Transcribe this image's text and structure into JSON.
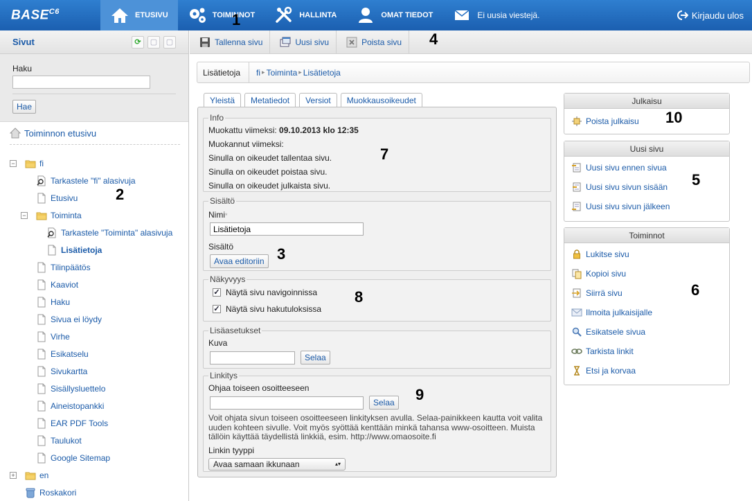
{
  "topbar": {
    "logo": "BASE",
    "logo_sup": "C6",
    "nav": [
      {
        "label": "ETUSIVU",
        "icon": "home-icon"
      },
      {
        "label": "TOIMINNOT",
        "icon": "gears-icon"
      },
      {
        "label": "HALLINTA",
        "icon": "tools-icon"
      },
      {
        "label": "OMAT TIEDOT",
        "icon": "user-icon"
      }
    ],
    "messages": "Ei uusia viestejä.",
    "logout": "Kirjaudu ulos"
  },
  "sidebar": {
    "title": "Sivut",
    "search_label": "Haku",
    "search_value": "",
    "search_button": "Hae",
    "home_link": "Toiminnon etusivu",
    "tree": [
      {
        "label": "fi",
        "type": "folder",
        "expander": "−"
      },
      {
        "label": "Tarkastele \"fi\" alasivuja",
        "type": "inspect"
      },
      {
        "label": "Etusivu",
        "type": "page"
      },
      {
        "label": "Toiminta",
        "type": "folder",
        "expander": "−"
      },
      {
        "label": "Tarkastele \"Toiminta\" alasivuja",
        "type": "inspect"
      },
      {
        "label": "Lisätietoja",
        "type": "page"
      },
      {
        "label": "Tilinpäätös",
        "type": "page"
      },
      {
        "label": "Kaaviot",
        "type": "page"
      },
      {
        "label": "Haku",
        "type": "page"
      },
      {
        "label": "Sivua ei löydy",
        "type": "page"
      },
      {
        "label": "Virhe",
        "type": "page"
      },
      {
        "label": "Esikatselu",
        "type": "page"
      },
      {
        "label": "Sivukartta",
        "type": "page"
      },
      {
        "label": "Sisällysluettelo",
        "type": "page"
      },
      {
        "label": "Aineistopankki",
        "type": "page"
      },
      {
        "label": "EAR PDF Tools",
        "type": "page"
      },
      {
        "label": "Taulukot",
        "type": "page"
      },
      {
        "label": "Google Sitemap",
        "type": "page"
      },
      {
        "label": "en",
        "type": "folder",
        "expander": "+"
      },
      {
        "label": "Roskakori",
        "type": "trash"
      }
    ]
  },
  "toolbar": {
    "save": "Tallenna sivu",
    "new": "Uusi sivu",
    "delete": "Poista sivu"
  },
  "breadcrumb": {
    "page": "Lisätietoja",
    "path": [
      "fi",
      "Toiminta",
      "Lisätietoja"
    ]
  },
  "tabs": [
    "Yleistä",
    "Metatiedot",
    "Versiot",
    "Muokkausoikeudet"
  ],
  "form": {
    "info_legend": "Info",
    "modified_label": "Muokattu viimeksi:",
    "modified_value": "09.10.2013 klo 12:35",
    "modified_by": "Muokannut viimeksi:",
    "rights": [
      "Sinulla on oikeudet tallentaa sivu.",
      "Sinulla on oikeudet poistaa sivu.",
      "Sinulla on oikeudet julkaista sivu."
    ],
    "content_legend": "Sisältö",
    "name_label": "Nimi",
    "name_required": "*",
    "name_value": "Lisätietoja",
    "content_label": "Sisältö",
    "editor_button": "Avaa editoriin",
    "visibility_legend": "Näkyvyys",
    "show_nav": "Näytä sivu navigoinnissa",
    "show_search": "Näytä sivu hakutuloksissa",
    "extra_legend": "Lisäasetukset",
    "image_label": "Kuva",
    "image_value": "",
    "browse": "Selaa",
    "link_legend": "Linkitys",
    "redirect_label": "Ohjaa toiseen osoitteeseen",
    "redirect_value": "",
    "help_text": "Voit ohjata sivun toiseen osoitteeseen linkityksen avulla. Selaa-painikkeen kautta voit valita uuden kohteen sivulle. Voit myös syöttää kenttään minkä tahansa www-osoitteen. Muista tällöin käyttää täydellistä linkkiä, esim. http://www.omaosoite.fi",
    "link_type_label": "Linkin tyyppi",
    "link_type_value": "Avaa samaan ikkunaan"
  },
  "panels": {
    "publish": {
      "title": "Julkaisu",
      "items": [
        "Poista julkaisu"
      ]
    },
    "newpage": {
      "title": "Uusi sivu",
      "items": [
        "Uusi sivu ennen sivua",
        "Uusi sivu sivun sisään",
        "Uusi sivu sivun jälkeen"
      ]
    },
    "actions": {
      "title": "Toiminnot",
      "items": [
        "Lukitse sivu",
        "Kopioi sivu",
        "Siirrä sivu",
        "Ilmoita julkaisijalle",
        "Esikatsele sivua",
        "Tarkista linkit",
        "Etsi ja korvaa"
      ]
    }
  },
  "callouts": [
    "1",
    "2",
    "3",
    "4",
    "5",
    "6",
    "7",
    "8",
    "9",
    "10"
  ],
  "colors": {
    "topbar": "#1b5fb0",
    "link": "#1a5aa8",
    "panel_bg": "#efefef"
  }
}
